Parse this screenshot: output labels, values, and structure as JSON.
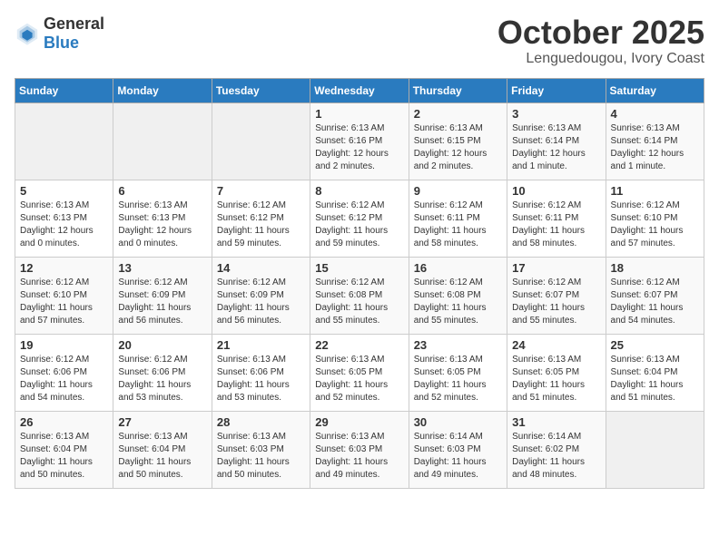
{
  "header": {
    "logo_general": "General",
    "logo_blue": "Blue",
    "month_year": "October 2025",
    "location": "Lenguedougou, Ivory Coast"
  },
  "weekdays": [
    "Sunday",
    "Monday",
    "Tuesday",
    "Wednesday",
    "Thursday",
    "Friday",
    "Saturday"
  ],
  "weeks": [
    [
      {
        "day": "",
        "sunrise": "",
        "sunset": "",
        "daylight": "",
        "empty": true
      },
      {
        "day": "",
        "sunrise": "",
        "sunset": "",
        "daylight": "",
        "empty": true
      },
      {
        "day": "",
        "sunrise": "",
        "sunset": "",
        "daylight": "",
        "empty": true
      },
      {
        "day": "1",
        "sunrise": "Sunrise: 6:13 AM",
        "sunset": "Sunset: 6:16 PM",
        "daylight": "Daylight: 12 hours and 2 minutes."
      },
      {
        "day": "2",
        "sunrise": "Sunrise: 6:13 AM",
        "sunset": "Sunset: 6:15 PM",
        "daylight": "Daylight: 12 hours and 2 minutes."
      },
      {
        "day": "3",
        "sunrise": "Sunrise: 6:13 AM",
        "sunset": "Sunset: 6:14 PM",
        "daylight": "Daylight: 12 hours and 1 minute."
      },
      {
        "day": "4",
        "sunrise": "Sunrise: 6:13 AM",
        "sunset": "Sunset: 6:14 PM",
        "daylight": "Daylight: 12 hours and 1 minute."
      }
    ],
    [
      {
        "day": "5",
        "sunrise": "Sunrise: 6:13 AM",
        "sunset": "Sunset: 6:13 PM",
        "daylight": "Daylight: 12 hours and 0 minutes."
      },
      {
        "day": "6",
        "sunrise": "Sunrise: 6:13 AM",
        "sunset": "Sunset: 6:13 PM",
        "daylight": "Daylight: 12 hours and 0 minutes."
      },
      {
        "day": "7",
        "sunrise": "Sunrise: 6:12 AM",
        "sunset": "Sunset: 6:12 PM",
        "daylight": "Daylight: 11 hours and 59 minutes."
      },
      {
        "day": "8",
        "sunrise": "Sunrise: 6:12 AM",
        "sunset": "Sunset: 6:12 PM",
        "daylight": "Daylight: 11 hours and 59 minutes."
      },
      {
        "day": "9",
        "sunrise": "Sunrise: 6:12 AM",
        "sunset": "Sunset: 6:11 PM",
        "daylight": "Daylight: 11 hours and 58 minutes."
      },
      {
        "day": "10",
        "sunrise": "Sunrise: 6:12 AM",
        "sunset": "Sunset: 6:11 PM",
        "daylight": "Daylight: 11 hours and 58 minutes."
      },
      {
        "day": "11",
        "sunrise": "Sunrise: 6:12 AM",
        "sunset": "Sunset: 6:10 PM",
        "daylight": "Daylight: 11 hours and 57 minutes."
      }
    ],
    [
      {
        "day": "12",
        "sunrise": "Sunrise: 6:12 AM",
        "sunset": "Sunset: 6:10 PM",
        "daylight": "Daylight: 11 hours and 57 minutes."
      },
      {
        "day": "13",
        "sunrise": "Sunrise: 6:12 AM",
        "sunset": "Sunset: 6:09 PM",
        "daylight": "Daylight: 11 hours and 56 minutes."
      },
      {
        "day": "14",
        "sunrise": "Sunrise: 6:12 AM",
        "sunset": "Sunset: 6:09 PM",
        "daylight": "Daylight: 11 hours and 56 minutes."
      },
      {
        "day": "15",
        "sunrise": "Sunrise: 6:12 AM",
        "sunset": "Sunset: 6:08 PM",
        "daylight": "Daylight: 11 hours and 55 minutes."
      },
      {
        "day": "16",
        "sunrise": "Sunrise: 6:12 AM",
        "sunset": "Sunset: 6:08 PM",
        "daylight": "Daylight: 11 hours and 55 minutes."
      },
      {
        "day": "17",
        "sunrise": "Sunrise: 6:12 AM",
        "sunset": "Sunset: 6:07 PM",
        "daylight": "Daylight: 11 hours and 55 minutes."
      },
      {
        "day": "18",
        "sunrise": "Sunrise: 6:12 AM",
        "sunset": "Sunset: 6:07 PM",
        "daylight": "Daylight: 11 hours and 54 minutes."
      }
    ],
    [
      {
        "day": "19",
        "sunrise": "Sunrise: 6:12 AM",
        "sunset": "Sunset: 6:06 PM",
        "daylight": "Daylight: 11 hours and 54 minutes."
      },
      {
        "day": "20",
        "sunrise": "Sunrise: 6:12 AM",
        "sunset": "Sunset: 6:06 PM",
        "daylight": "Daylight: 11 hours and 53 minutes."
      },
      {
        "day": "21",
        "sunrise": "Sunrise: 6:13 AM",
        "sunset": "Sunset: 6:06 PM",
        "daylight": "Daylight: 11 hours and 53 minutes."
      },
      {
        "day": "22",
        "sunrise": "Sunrise: 6:13 AM",
        "sunset": "Sunset: 6:05 PM",
        "daylight": "Daylight: 11 hours and 52 minutes."
      },
      {
        "day": "23",
        "sunrise": "Sunrise: 6:13 AM",
        "sunset": "Sunset: 6:05 PM",
        "daylight": "Daylight: 11 hours and 52 minutes."
      },
      {
        "day": "24",
        "sunrise": "Sunrise: 6:13 AM",
        "sunset": "Sunset: 6:05 PM",
        "daylight": "Daylight: 11 hours and 51 minutes."
      },
      {
        "day": "25",
        "sunrise": "Sunrise: 6:13 AM",
        "sunset": "Sunset: 6:04 PM",
        "daylight": "Daylight: 11 hours and 51 minutes."
      }
    ],
    [
      {
        "day": "26",
        "sunrise": "Sunrise: 6:13 AM",
        "sunset": "Sunset: 6:04 PM",
        "daylight": "Daylight: 11 hours and 50 minutes."
      },
      {
        "day": "27",
        "sunrise": "Sunrise: 6:13 AM",
        "sunset": "Sunset: 6:04 PM",
        "daylight": "Daylight: 11 hours and 50 minutes."
      },
      {
        "day": "28",
        "sunrise": "Sunrise: 6:13 AM",
        "sunset": "Sunset: 6:03 PM",
        "daylight": "Daylight: 11 hours and 50 minutes."
      },
      {
        "day": "29",
        "sunrise": "Sunrise: 6:13 AM",
        "sunset": "Sunset: 6:03 PM",
        "daylight": "Daylight: 11 hours and 49 minutes."
      },
      {
        "day": "30",
        "sunrise": "Sunrise: 6:14 AM",
        "sunset": "Sunset: 6:03 PM",
        "daylight": "Daylight: 11 hours and 49 minutes."
      },
      {
        "day": "31",
        "sunrise": "Sunrise: 6:14 AM",
        "sunset": "Sunset: 6:02 PM",
        "daylight": "Daylight: 11 hours and 48 minutes."
      },
      {
        "day": "",
        "sunrise": "",
        "sunset": "",
        "daylight": "",
        "empty": true
      }
    ]
  ]
}
